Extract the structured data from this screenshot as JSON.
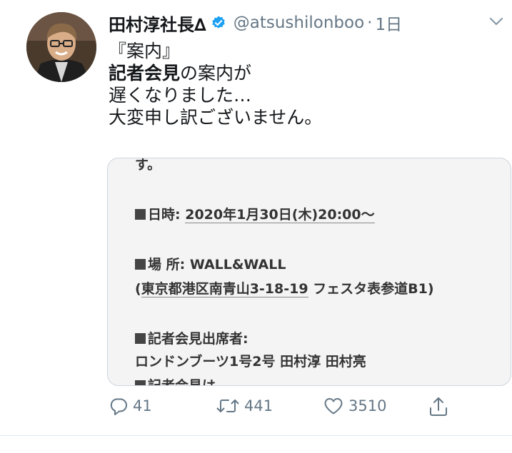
{
  "tweet": {
    "display_name": "田村淳社長∆",
    "handle": "@atsushilonboo",
    "separator": "·",
    "time": "1日",
    "body": {
      "line1": "『案内』",
      "line2_bold": "記者会見",
      "line2_rest": "の案内が",
      "line3": "遅くなりました…",
      "line4": "大変申し訳ございません。"
    }
  },
  "media": {
    "top_fragment": "す。",
    "date_label": "日時:",
    "date_value": "2020年1月30日(木)20:00〜",
    "place_label": "場 所:",
    "place_value": "WALL&WALL",
    "address_open": "(",
    "address_link": "東京都港区南青山3-18-19",
    "address_rest": " フェスタ表参道B1)",
    "attendees_label": "記者会見出席者:",
    "attendees_value": "ロンドンブーツ1号2号 田村淳 田村亮",
    "cut_off": "記者会見は"
  },
  "actions": {
    "reply_count": "41",
    "retweet_count": "441",
    "like_count": "3510"
  },
  "colors": {
    "text": "#14171a",
    "secondary": "#657786",
    "verified": "#1da1f2",
    "border": "#ccd6dd"
  },
  "icons": [
    "verified-badge-icon",
    "chevron-down-icon",
    "reply-icon",
    "retweet-icon",
    "like-icon",
    "share-icon"
  ]
}
